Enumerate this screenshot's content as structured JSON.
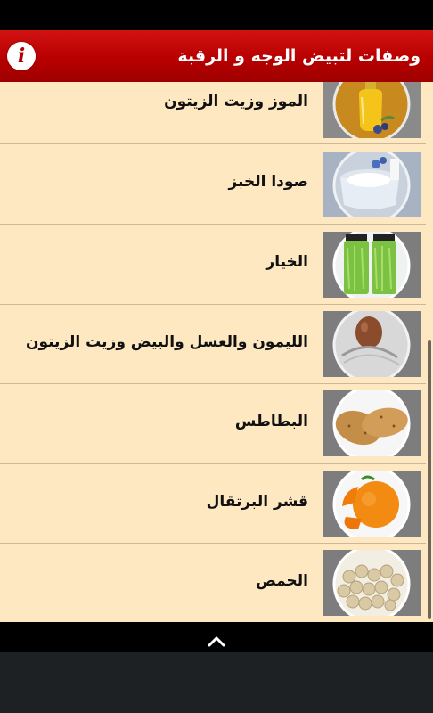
{
  "header": {
    "title": "وصفات لتبيض الوجه و الرقبة",
    "info_icon": "i"
  },
  "items": [
    {
      "label": "الموز وزيت الزيتون",
      "icon": "olive-oil-icon"
    },
    {
      "label": "صودا الخبز",
      "icon": "baking-soda-icon"
    },
    {
      "label": "الخيار",
      "icon": "cucumber-juice-icon"
    },
    {
      "label": "الليمون والعسل والبيض وزيت الزيتون",
      "icon": "egg-icon"
    },
    {
      "label": "البطاطس",
      "icon": "potato-icon"
    },
    {
      "label": "قشر البرتقال",
      "icon": "orange-peel-icon"
    },
    {
      "label": "الحمص",
      "icon": "chickpeas-icon"
    }
  ],
  "colors": {
    "header": "#b80000",
    "list_background": "#fde8c2",
    "divider": "#cbb79a"
  }
}
